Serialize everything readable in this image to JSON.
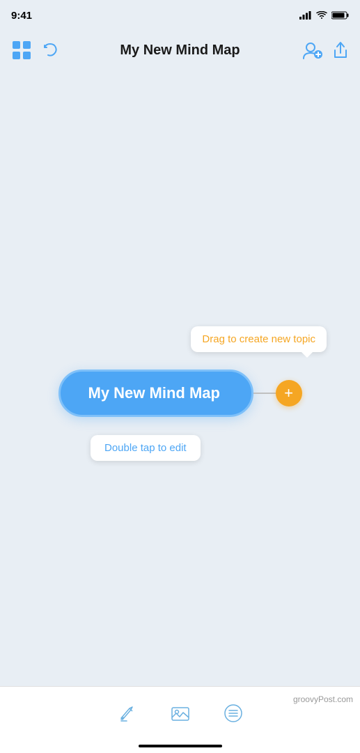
{
  "app": {
    "title": "My New Mind Map",
    "status_time": "9:41"
  },
  "nav": {
    "title": "My New Mind Map",
    "undo_icon": "↩",
    "add_user_icon": "👤",
    "share_icon": "⬆"
  },
  "canvas": {
    "node_text": "My New Mind Map",
    "tooltip_drag": "Drag to create new topic",
    "tooltip_edit": "Double tap to edit"
  },
  "toolbar": {
    "pen_icon": "pen",
    "image_icon": "image",
    "menu_icon": "menu"
  },
  "watermark": {
    "text": "groovyPost.com"
  },
  "colors": {
    "accent_blue": "#4da6f5",
    "accent_orange": "#f5a623",
    "bg": "#e8eef4",
    "white": "#ffffff"
  }
}
